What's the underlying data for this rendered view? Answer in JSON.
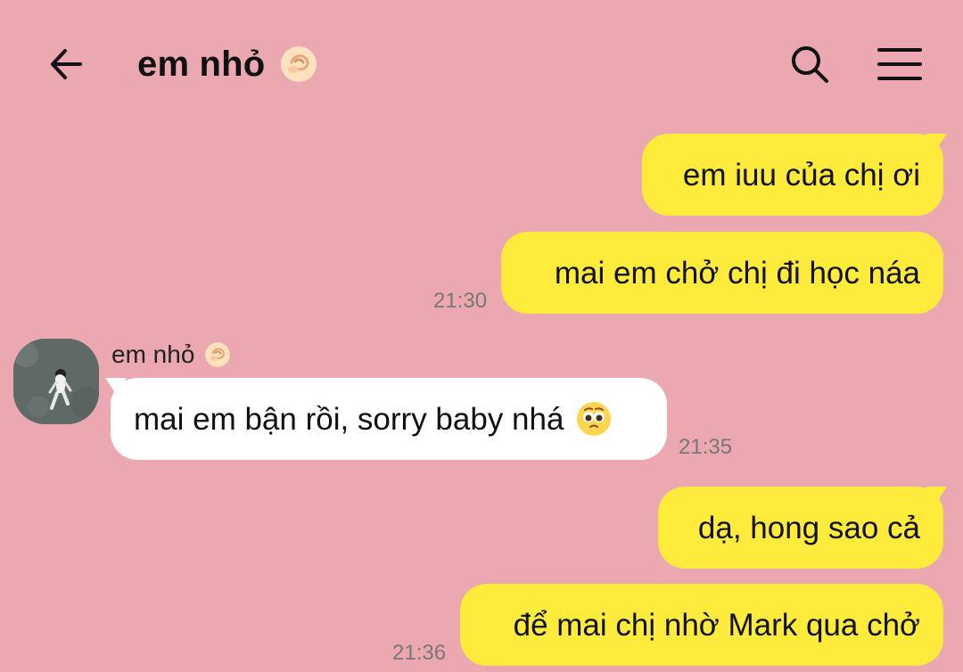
{
  "header": {
    "title": "em nhỏ",
    "title_icon": "pinching-hand-emoji",
    "actions": [
      "search-icon",
      "menu-icon"
    ],
    "back_icon": "back-arrow-icon"
  },
  "colors": {
    "background": "#eca8b1",
    "outgoing_bubble": "#ffeb3b",
    "incoming_bubble": "#ffffff",
    "timestamp": "#777777"
  },
  "messages": [
    {
      "direction": "outgoing",
      "text": "em iuu của chị ơi",
      "time": ""
    },
    {
      "direction": "outgoing",
      "text": "mai em chở chị đi học náa",
      "time": "21:30"
    },
    {
      "direction": "incoming",
      "sender": "em nhỏ",
      "sender_icon": "pinching-hand-emoji",
      "text": "mai em bận rồi, sorry baby nhá",
      "emoji": "pleading-face-emoji",
      "time": "21:35"
    },
    {
      "direction": "outgoing",
      "text": "dạ, hong sao cả",
      "time": ""
    },
    {
      "direction": "outgoing",
      "text": "để mai chị nhờ Mark qua chở",
      "time": "21:36"
    }
  ]
}
